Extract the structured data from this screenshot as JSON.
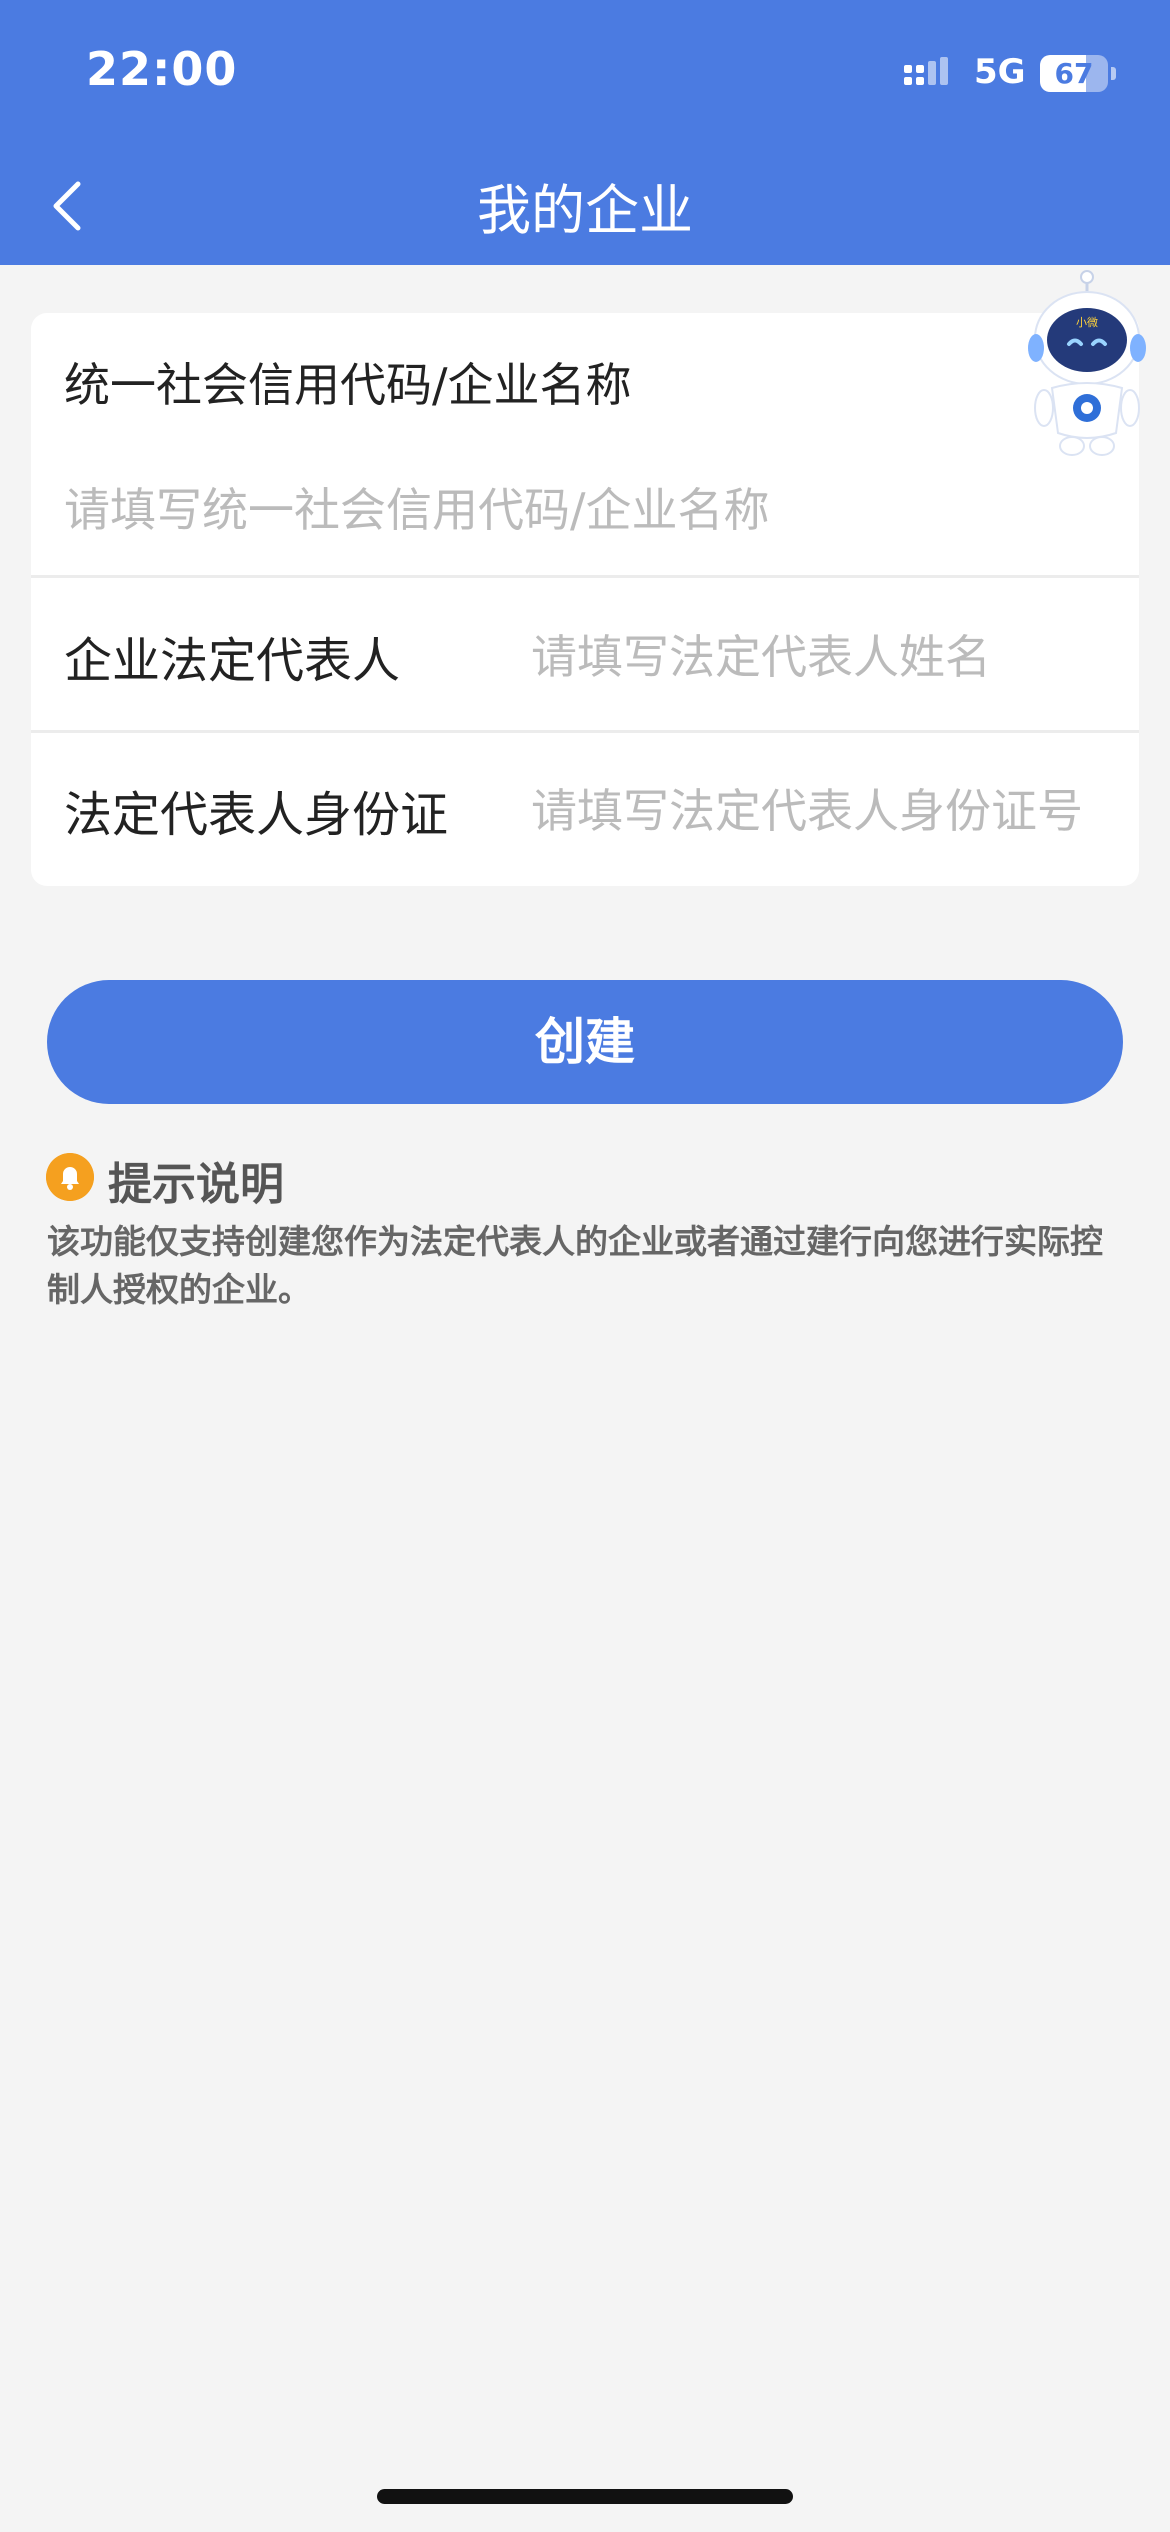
{
  "status_bar": {
    "time": "22:00",
    "network": "5G",
    "battery": "67",
    "battery_level": 0.67
  },
  "nav": {
    "title": "我的企业"
  },
  "form": {
    "credit_code": {
      "label": "统一社会信用代码/企业名称",
      "placeholder": "请填写统一社会信用代码/企业名称"
    },
    "legal_rep": {
      "label": "企业法定代表人",
      "placeholder": "请填写法定代表人姓名"
    },
    "legal_rep_id": {
      "label": "法定代表人身份证",
      "placeholder": "请填写法定代表人身份证号"
    }
  },
  "actions": {
    "create_label": "创建"
  },
  "tips": {
    "title": "提示说明",
    "text": "该功能仅支持创建您作为法定代表人的企业或者通过建行向您进行实际控制人授权的企业。"
  },
  "robot": {
    "badge_text": "小微"
  },
  "colors": {
    "brand": "#4b7be1",
    "tip_icon": "#f5a01f"
  }
}
